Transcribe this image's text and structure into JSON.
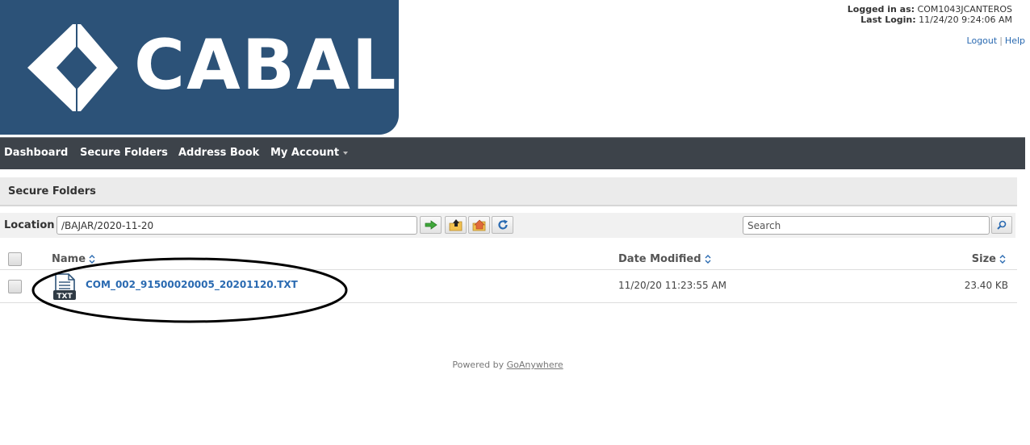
{
  "brand": {
    "logo_text": "CABAL",
    "logo_color": "#2c5278"
  },
  "user": {
    "logged_label": "Logged in as:",
    "logged_value": "COM1043JCANTEROS",
    "last_login_label": "Last Login:",
    "last_login_value": "11/24/20 9:24:06 AM"
  },
  "toplinks": {
    "logout": "Logout",
    "separator": "|",
    "help": "Help"
  },
  "nav": {
    "dashboard": "Dashboard",
    "secure_folders": "Secure Folders",
    "address_book": "Address Book",
    "my_account": "My Account"
  },
  "section": {
    "title": "Secure Folders"
  },
  "location": {
    "label": "Location",
    "value": "/BAJAR/2020-11-20",
    "buttons": [
      "go-arrow-icon",
      "folder-up-icon",
      "home-folder-icon",
      "refresh-icon"
    ]
  },
  "search": {
    "placeholder": "Search",
    "icon": "search-icon"
  },
  "table": {
    "columns": {
      "name": "Name",
      "date": "Date Modified",
      "size": "Size"
    },
    "rows": [
      {
        "icon_label": "TXT",
        "name": "COM_002_91500020005_20201120.TXT",
        "date": "11/20/20 11:23:55 AM",
        "size": "23.40 KB"
      }
    ]
  },
  "footer": {
    "text": "Powered by",
    "link": "GoAnywhere"
  },
  "colors": {
    "nav_bg": "#3d434a",
    "link": "#2a6ab1"
  }
}
